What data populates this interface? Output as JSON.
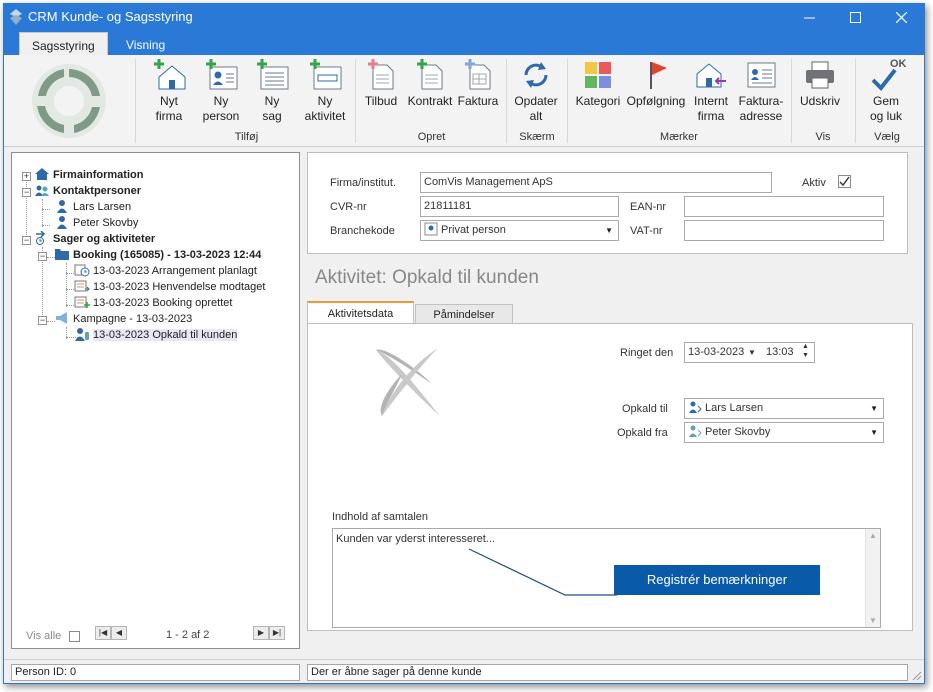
{
  "window": {
    "title": "CRM Kunde- og Sagsstyring",
    "accent_color": "#2b79d7",
    "controls": [
      "minimize-icon",
      "maximize-icon",
      "close-icon"
    ]
  },
  "ribbon_tabs": [
    {
      "label": "Sagsstyring",
      "active": true
    },
    {
      "label": "Visning",
      "active": false
    }
  ],
  "ribbon": {
    "groups": {
      "tilfoej": "Tilføj",
      "opret": "Opret",
      "skaerm": "Skærm",
      "maerker": "Mærker",
      "vis": "Vis",
      "vaelg": "Vælg"
    },
    "buttons": {
      "nyt_firma": [
        "Nyt",
        "firma"
      ],
      "ny_person": [
        "Ny",
        "person"
      ],
      "ny_sag": [
        "Ny",
        "sag"
      ],
      "ny_aktivitet": [
        "Ny",
        "aktivitet"
      ],
      "tilbud": "Tilbud",
      "kontrakt": "Kontrakt",
      "faktura": "Faktura",
      "opdater": [
        "Opdater",
        "alt"
      ],
      "kategori": "Kategori",
      "opfoelgning": "Opfølgning",
      "internt_firma": [
        "Internt",
        "firma"
      ],
      "fakturaadresse": [
        "Faktura-",
        "adresse"
      ],
      "udskriv": "Udskriv",
      "gem_luk": [
        "Gem",
        "og luk"
      ],
      "gem_luk_badge": "OK"
    }
  },
  "tree": {
    "firmainformation": "Firmainformation",
    "kontaktpersoner": "Kontaktpersoner",
    "person1": "Lars Larsen",
    "person2": "Peter Skovby",
    "sager": "Sager og aktiviteter",
    "booking": "Booking (165085) - 13-03-2023  12:44",
    "act1": "13-03-2023 Arrangement planlagt",
    "act2": "13-03-2023 Henvendelse modtaget",
    "act3": "13-03-2023 Booking oprettet",
    "kampagne": "Kampagne - 13-03-2023",
    "act4": "13-03-2023 Opkald til kunden"
  },
  "left_footer": {
    "vis_alle": "Vis alle",
    "paging": "1 - 2 af 2"
  },
  "form": {
    "firma_label": "Firma/institut.",
    "firma_value": "ComVis Management ApS",
    "aktiv_label": "Aktiv",
    "aktiv_checked": true,
    "cvr_label": "CVR-nr",
    "cvr_value": "21811181",
    "ean_label": "EAN-nr",
    "ean_value": "",
    "branche_label": "Branchekode",
    "branche_value": "Privat person",
    "vat_label": "VAT-nr",
    "vat_value": ""
  },
  "activity": {
    "heading": "Aktivitet: Opkald til kunden",
    "tabs": [
      "Aktivitetsdata",
      "Påmindelser"
    ],
    "ringet_label": "Ringet den",
    "date": "13-03-2023",
    "time": "13:03",
    "opkald_til_label": "Opkald til",
    "opkald_til": "Lars Larsen",
    "opkald_fra_label": "Opkald fra",
    "opkald_fra": "Peter Skovby",
    "indhold_label": "Indhold af samtalen",
    "indhold_value": "Kunden var yderst interesseret...",
    "register_button": "Registrér bemærkninger"
  },
  "status": {
    "left": "Person ID: 0",
    "right": "Der er åbne sager på denne kunde"
  }
}
